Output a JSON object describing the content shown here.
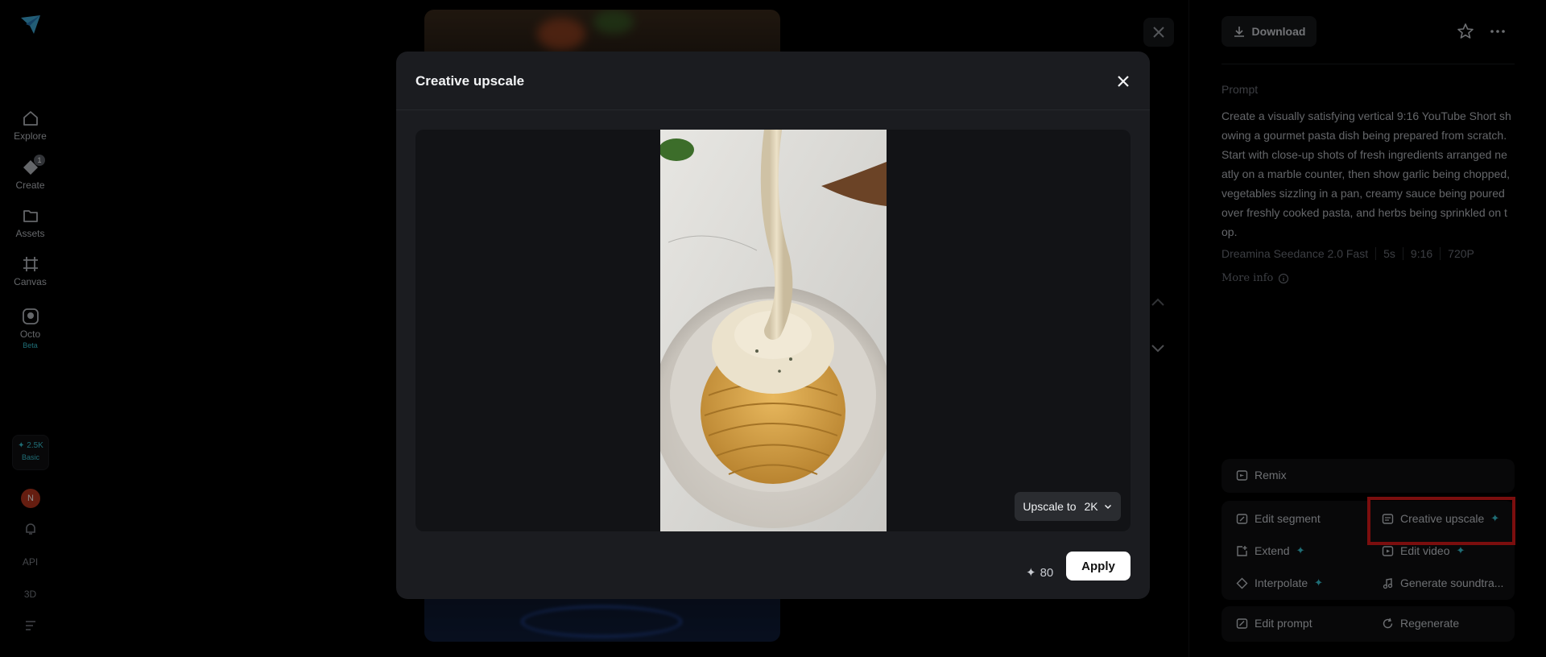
{
  "rail": {
    "items": [
      {
        "label": "Explore",
        "icon": "home-icon"
      },
      {
        "label": "Create",
        "icon": "create-icon",
        "badge": "1"
      },
      {
        "label": "Assets",
        "icon": "folder-icon"
      },
      {
        "label": "Canvas",
        "icon": "canvas-icon"
      },
      {
        "label": "Octo",
        "icon": "octo-icon",
        "tag": "Beta"
      }
    ],
    "credits": {
      "value": "✦ 2.5K",
      "tier": "Basic"
    },
    "avatar": "N",
    "api_label": "API",
    "three_d_label": "3D"
  },
  "panel": {
    "download_label": "Download",
    "prompt_label": "Prompt",
    "prompt_text": "Create a visually satisfying vertical 9:16 YouTube Short showing a gourmet pasta dish being prepared from scratch. Start with close-up shots of fresh ingredients arranged neatly on a marble counter, then show garlic being chopped, vegetables sizzling in a pan, creamy sauce being poured over freshly cooked pasta, and herbs being sprinkled on top.",
    "meta": [
      "Dreamina Seedance 2.0 Fast",
      "5s",
      "9:16",
      "720P"
    ],
    "more_info": "More info",
    "actions": {
      "remix": "Remix",
      "edit_segment": "Edit segment",
      "creative_upscale": "Creative upscale",
      "extend": "Extend",
      "edit_video": "Edit video",
      "interpolate": "Interpolate",
      "generate_soundtrack": "Generate soundtra...",
      "edit_prompt": "Edit prompt",
      "regenerate": "Regenerate",
      "plus_glyph": "✦"
    }
  },
  "modal": {
    "title": "Creative upscale",
    "upscale_prefix": "Upscale to",
    "upscale_value": "2K",
    "cost_glyph": "✦",
    "cost": "80",
    "apply_label": "Apply"
  },
  "colors": {
    "accent": "#39c6d6",
    "highlight": "#e01b1b",
    "modal_bg": "#1b1c20"
  }
}
